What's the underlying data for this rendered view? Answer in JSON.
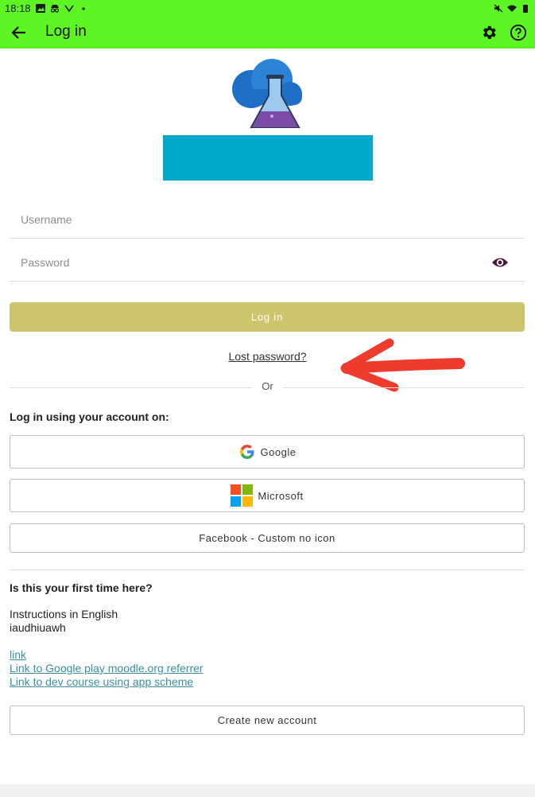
{
  "status_bar": {
    "time": "18:18"
  },
  "app_bar": {
    "title": "Log in"
  },
  "icons": {
    "back": "arrow-left-icon",
    "settings": "gear-icon",
    "help": "help-circle-icon",
    "password_visibility": "eye-icon",
    "google": "google-logo-icon",
    "microsoft": "microsoft-logo-icon"
  },
  "form": {
    "username_placeholder": "Username",
    "username_value": "",
    "password_placeholder": "Password",
    "password_value": "",
    "login_label": "Log in",
    "lost_password": "Lost password?",
    "or": "Or"
  },
  "identity_providers": {
    "heading": "Log in using your account on:",
    "items": [
      {
        "label": "Google"
      },
      {
        "label": "Microsoft"
      },
      {
        "label": "Facebook - Custom no icon"
      }
    ]
  },
  "signup": {
    "heading": "Is this your first time here?",
    "instructions_line1": "Instructions in English",
    "instructions_line2": "iaudhiuawh",
    "links": [
      "link",
      "Link to Google play moodle.org referrer",
      "Link to dev course using app scheme"
    ],
    "create_account_label": "Create new account"
  },
  "colors": {
    "app_bar_bg": "#5ef524",
    "login_button_bg": "#cdc56c",
    "banner_bg": "#00a8cc",
    "link": "#3a8fa5",
    "annotation_arrow": "#ee3b2e"
  }
}
